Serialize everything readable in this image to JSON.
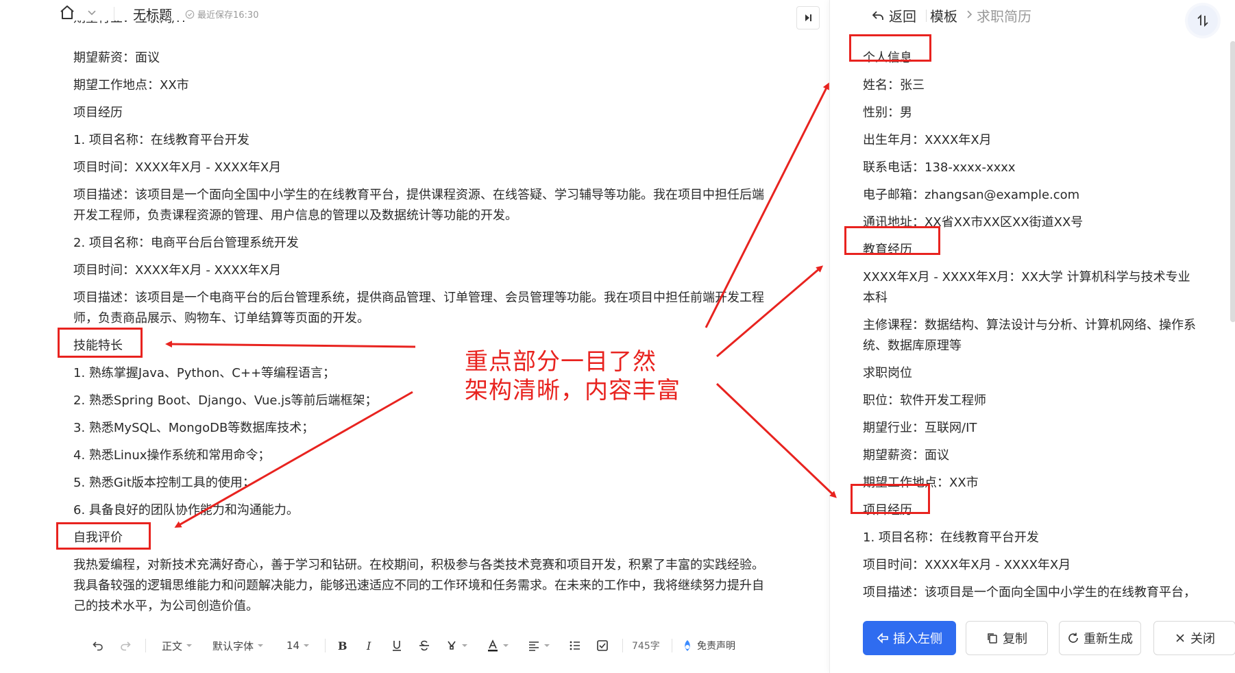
{
  "colors": {
    "accent": "#2f6cf0",
    "annotation": "#e8231f"
  },
  "editor": {
    "title": "无标题",
    "save_status": "最近保存16:30",
    "cut_top_line": "期望行业：互联网/IT",
    "paragraphs": [
      "期望薪资：面议",
      "期望工作地点：XX市",
      "项目经历",
      "1. 项目名称：在线教育平台开发",
      "项目时间：XXXX年X月 - XXXX年X月",
      "项目描述：该项目是一个面向全国中小学生的在线教育平台，提供课程资源、在线答疑、学习辅导等功能。我在项目中担任后端开发工程师，负责课程资源的管理、用户信息的管理以及数据统计等功能的开发。",
      "2. 项目名称：电商平台后台管理系统开发",
      "项目时间：XXXX年X月 - XXXX年X月",
      "项目描述：该项目是一个电商平台的后台管理系统，提供商品管理、订单管理、会员管理等功能。我在项目中担任前端开发工程师，负责商品展示、购物车、订单结算等页面的开发。",
      "技能特长",
      "1. 熟练掌握Java、Python、C++等编程语言；",
      "2. 熟悉Spring Boot、Django、Vue.js等前后端框架；",
      "3. 熟悉MySQL、MongoDB等数据库技术；",
      "4. 熟悉Linux操作系统和常用命令；",
      "5. 熟悉Git版本控制工具的使用；",
      "6. 具备良好的团队协作能力和沟通能力。",
      "自我评价",
      "我热爱编程，对新技术充满好奇心，善于学习和钻研。在校期间，积极参与各类技术竞赛和项目开发，积累了丰富的实践经验。我具备较强的逻辑思维能力和问题解决能力，能够迅速适应不同的工作环境和任务需求。在未来的工作中，我将继续努力提升自己的技术水平，为公司创造价值。"
    ]
  },
  "toolbar": {
    "style": "正文",
    "font": "默认字体",
    "size": "14",
    "word_count": "745字",
    "disclaimer": "免责声明"
  },
  "panel": {
    "back": "返回",
    "crumb_root": "模板",
    "crumb_current": "求职简历",
    "lines": [
      "个人信息",
      "姓名：张三",
      "性别：男",
      "出生年月：XXXX年X月",
      "联系电话：138-xxxx-xxxx",
      "电子邮箱：zhangsan@example.com",
      "通讯地址：XX省XX市XX区XX街道XX号",
      "教育经历",
      "XXXX年X月 - XXXX年X月：XX大学 计算机科学与技术专业 本科",
      "主修课程：数据结构、算法设计与分析、计算机网络、操作系统、数据库原理等",
      "求职岗位",
      "职位：软件开发工程师",
      "期望行业：互联网/IT",
      "期望薪资：面议",
      "期望工作地点：XX市",
      "项目经历",
      "1. 项目名称：在线教育平台开发",
      "项目时间：XXXX年X月 - XXXX年X月",
      "项目描述：该项目是一个面向全国中小学生的在线教育平台，提供课程资源、在线答疑、学习辅导等功能。我在项目中担任后端"
    ],
    "buttons": {
      "insert": "插入左侧",
      "copy": "复制",
      "regenerate": "重新生成",
      "close": "关闭"
    }
  },
  "annotation": {
    "line1": "重点部分一目了然",
    "line2": "架构清晰，内容丰富"
  }
}
